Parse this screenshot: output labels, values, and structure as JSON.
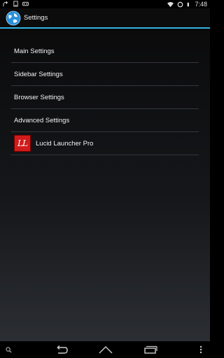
{
  "status_bar": {
    "time": "7:48",
    "left_icons": [
      "notification-plus-icon",
      "tablet-icon",
      "gamepad-icon"
    ],
    "right_icons": [
      "wifi-icon",
      "sync-icon",
      "battery-icon"
    ]
  },
  "action_bar": {
    "title": "Settings",
    "icon": "globe-icon",
    "accent_color": "#33b5e5"
  },
  "settings": {
    "items": [
      {
        "label": "Main Settings"
      },
      {
        "label": "Sidebar Settings"
      },
      {
        "label": "Browser Settings"
      },
      {
        "label": "Advanced Settings"
      },
      {
        "label": "Lucid Launcher Pro",
        "icon": "lucid-launcher-icon",
        "icon_text": "LL"
      }
    ]
  },
  "nav_bar": {
    "buttons": [
      "search-icon",
      "back-icon",
      "home-icon",
      "recents-icon",
      "overflow-menu-icon"
    ]
  }
}
